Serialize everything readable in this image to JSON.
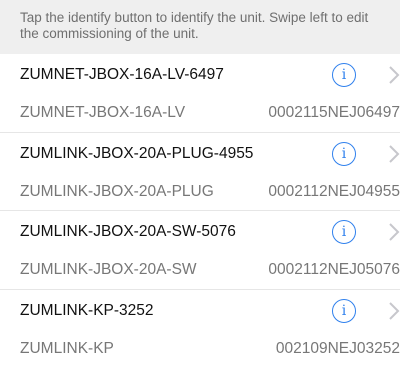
{
  "info_banner": {
    "text": "Tap the identify button to identify the unit. Swipe left to edit the commissioning of the unit."
  },
  "units": [
    {
      "name": "ZUMNET-JBOX-16A-LV-6497",
      "model": "ZUMNET-JBOX-16A-LV",
      "serial": "0002115NEJ06497",
      "identify_icon": "info-circle-icon",
      "detail_icon": "chevron-right-icon"
    },
    {
      "name": "ZUMLINK-JBOX-20A-PLUG-4955",
      "model": "ZUMLINK-JBOX-20A-PLUG",
      "serial": "0002112NEJ04955",
      "identify_icon": "info-circle-icon",
      "detail_icon": "chevron-right-icon"
    },
    {
      "name": "ZUMLINK-JBOX-20A-SW-5076",
      "model": "ZUMLINK-JBOX-20A-SW",
      "serial": "0002112NEJ05076",
      "identify_icon": "info-circle-icon",
      "detail_icon": "chevron-right-icon"
    },
    {
      "name": "ZUMLINK-KP-3252",
      "model": "ZUMLINK-KP",
      "serial": "002109NEJ03252",
      "identify_icon": "info-circle-icon",
      "detail_icon": "chevron-right-icon"
    }
  ],
  "colors": {
    "accent": "#2f80ed",
    "banner_background": "#efefef",
    "secondary_text": "#777777",
    "chevron": "#c7c7cc"
  }
}
